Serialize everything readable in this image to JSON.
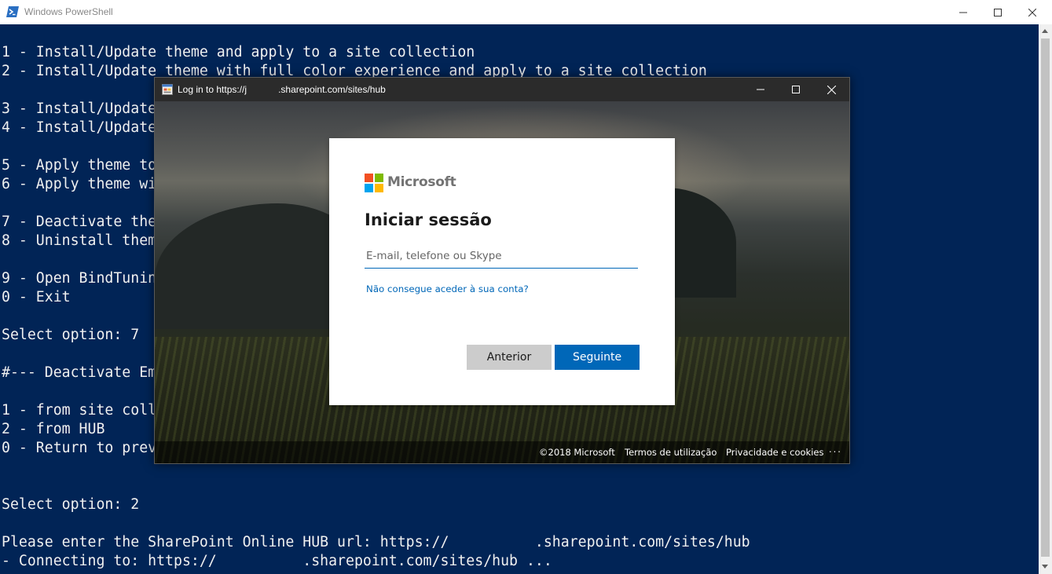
{
  "powershell": {
    "title": "Windows PowerShell",
    "lines": [
      "1 - Install/Update theme and apply to a site collection",
      "2 - Install/Update theme with full color experience and apply to a site collection",
      "",
      "3 - Install/Update",
      "4 - Install/Update",
      "",
      "5 - Apply theme to",
      "6 - Apply theme wi",
      "",
      "7 - Deactivate the",
      "8 - Uninstall them",
      "",
      "9 - Open BindTunin",
      "0 - Exit",
      "",
      "Select option: 7",
      "",
      "#--- Deactivate Em",
      "",
      "1 - from site coll",
      "2 - from HUB",
      "0 - Return to prev",
      "",
      "",
      "Select option: 2",
      "",
      "Please enter the SharePoint Online HUB url: https://          .sharepoint.com/sites/hub",
      "- Connecting to: https://          .sharepoint.com/sites/hub ..."
    ]
  },
  "dialog": {
    "title": "Log in to https://j            .sharepoint.com/sites/hub",
    "brand": "Microsoft",
    "heading": "Iniciar sessão",
    "input_placeholder": "E-mail, telefone ou Skype",
    "input_value": "",
    "help_link": "Não consegue aceder à sua conta?",
    "back_label": "Anterior",
    "next_label": "Seguinte",
    "footer": {
      "copyright": "©2018 Microsoft",
      "terms": "Termos de utilização",
      "privacy": "Privacidade e cookies",
      "more": "..."
    },
    "colors": {
      "accent": "#0067b8",
      "logo_red": "#f25022",
      "logo_green": "#7fba00",
      "logo_blue": "#00a4ef",
      "logo_yellow": "#ffb900"
    }
  }
}
